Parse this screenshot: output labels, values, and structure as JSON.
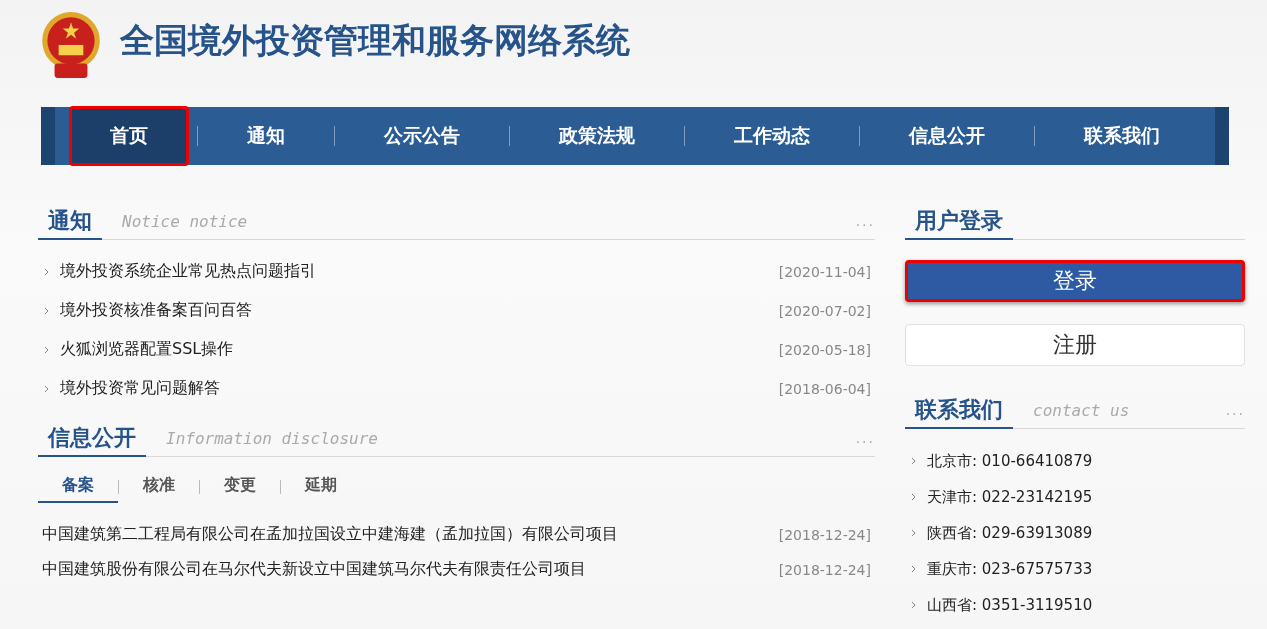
{
  "site_title": "全国境外投资管理和服务网络系统",
  "nav": [
    {
      "label": "首页",
      "selected": true
    },
    {
      "label": "通知",
      "selected": false
    },
    {
      "label": "公示公告",
      "selected": false
    },
    {
      "label": "政策法规",
      "selected": false
    },
    {
      "label": "工作动态",
      "selected": false
    },
    {
      "label": "信息公开",
      "selected": false
    },
    {
      "label": "联系我们",
      "selected": false
    }
  ],
  "notice": {
    "title": "通知",
    "subtitle": "Notice notice",
    "more": "...",
    "items": [
      {
        "text": "境外投资系统企业常见热点问题指引",
        "date": "[2020-11-04]"
      },
      {
        "text": "境外投资核准备案百问百答",
        "date": "[2020-07-02]"
      },
      {
        "text": "火狐浏览器配置SSL操作",
        "date": "[2020-05-18]"
      },
      {
        "text": "境外投资常见问题解答",
        "date": "[2018-06-04]"
      }
    ]
  },
  "disclosure": {
    "title": "信息公开",
    "subtitle": "Information disclosure",
    "more": "...",
    "tabs": [
      {
        "label": "备案",
        "selected": true
      },
      {
        "label": "核准",
        "selected": false
      },
      {
        "label": "变更",
        "selected": false
      },
      {
        "label": "延期",
        "selected": false
      }
    ],
    "items": [
      {
        "text": "中国建筑第二工程局有限公司在孟加拉国设立中建海建（孟加拉国）有限公司项目",
        "date": "[2018-12-24]"
      },
      {
        "text": "中国建筑股份有限公司在马尔代夫新设立中国建筑马尔代夫有限责任公司项目",
        "date": "[2018-12-24]"
      }
    ]
  },
  "login": {
    "title": "用户登录",
    "buttons": [
      {
        "label": "登录",
        "kind": "primary",
        "highlighted": true
      },
      {
        "label": "注册",
        "kind": "secondary",
        "highlighted": false
      }
    ]
  },
  "contact": {
    "title": "联系我们",
    "subtitle": "contact us",
    "more": "...",
    "items": [
      "北京市: 010-66410879",
      "天津市: 022-23142195",
      "陕西省: 029-63913089",
      "重庆市: 023-67575733",
      "山西省: 0351-3119510"
    ]
  }
}
